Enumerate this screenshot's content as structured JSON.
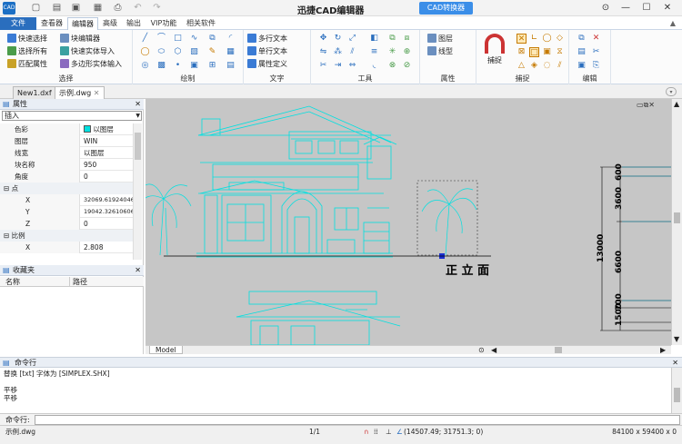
{
  "app": {
    "title": "迅捷CAD编辑器",
    "converter_label": "CAD转换器",
    "logo_text": "CAD"
  },
  "menu": {
    "file": "文件",
    "tabs": [
      "查看器",
      "编辑器",
      "高级",
      "输出",
      "VIP功能",
      "相关软件"
    ]
  },
  "ribbon": {
    "select": {
      "label": "选择",
      "items": [
        "快速选择",
        "选择所有",
        "匹配属性",
        "块编辑器",
        "快速实体导入",
        "多边形实体输入"
      ]
    },
    "draw": {
      "label": "绘制"
    },
    "text": {
      "label": "文字",
      "items": [
        "多行文本",
        "单行文本",
        "属性定义"
      ]
    },
    "tools": {
      "label": "工具"
    },
    "props": {
      "label": "属性",
      "items": [
        "图层",
        "线型"
      ]
    },
    "snap": {
      "label": "捕捉",
      "big_label": "捕捉"
    },
    "edit": {
      "label": "编辑"
    }
  },
  "doc_tabs": [
    "New1.dxf",
    "示例.dwg"
  ],
  "properties": {
    "header": "属性",
    "dropdown": "插入",
    "rows": [
      {
        "k": "色彩",
        "v": "以图层"
      },
      {
        "k": "图层",
        "v": "WIN"
      },
      {
        "k": "线宽",
        "v": "以图层"
      },
      {
        "k": "块名称",
        "v": "950"
      },
      {
        "k": "角度",
        "v": "0"
      }
    ],
    "sec_point": "点",
    "point_rows": [
      {
        "k": "X",
        "v": "32069.619240462"
      },
      {
        "k": "Y",
        "v": "19042.326106067"
      },
      {
        "k": "Z",
        "v": "0"
      }
    ],
    "sec_scale": "比例",
    "scale_rows": [
      {
        "k": "X",
        "v": "2.808"
      }
    ]
  },
  "favorites": {
    "header": "收藏夹",
    "col_name": "名称",
    "col_path": "路径"
  },
  "canvas": {
    "elevation_label": "正 立 面",
    "dims": [
      "600",
      "3600",
      "13000",
      "6600",
      "1500",
      "700"
    ],
    "model_tab": "Model"
  },
  "command": {
    "header": "命令行",
    "log": [
      "替换 [txt] 字体为 [SIMPLEX.SHX]",
      "",
      "平移",
      "平移"
    ],
    "prompt": "命令行:"
  },
  "status": {
    "file": "示例.dwg",
    "page": "1/1",
    "coords": "(14507.49; 31751.3; 0)",
    "size": "84100 x 59400 x 0"
  },
  "colors": {
    "accent": "#2a6ebe",
    "cad_line": "#00e0e0",
    "canvas_bg": "#c6c6c6"
  }
}
